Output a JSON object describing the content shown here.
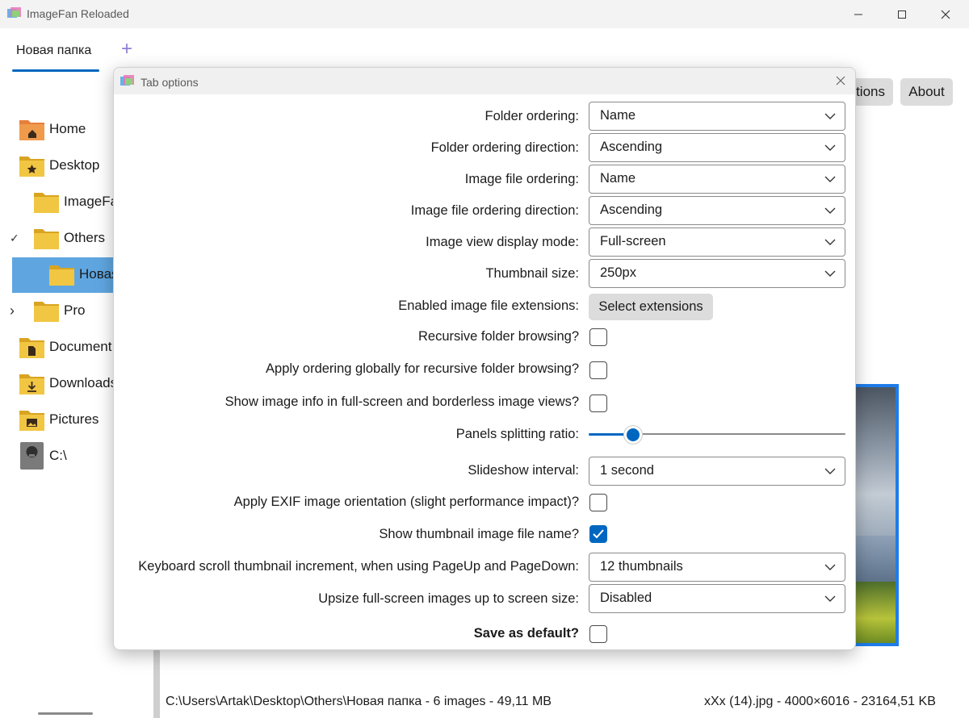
{
  "window": {
    "title": "ImageFan Reloaded",
    "tab": "Новая папка",
    "add_tab": "+",
    "options_label": "tions",
    "about_label": "About"
  },
  "sidebar": {
    "items": [
      {
        "label": "Home",
        "icon": "home-folder-icon"
      },
      {
        "label": "Desktop",
        "icon": "desktop-folder-icon"
      },
      {
        "label": "ImageFa",
        "icon": "folder-icon"
      },
      {
        "label": "Others",
        "icon": "folder-icon",
        "arrow": "✓"
      },
      {
        "label": "Новая",
        "icon": "folder-icon"
      },
      {
        "label": "Pro",
        "icon": "folder-icon",
        "arrow": "›"
      },
      {
        "label": "Document",
        "icon": "documents-folder-icon"
      },
      {
        "label": "Downloads",
        "icon": "downloads-folder-icon"
      },
      {
        "label": "Pictures",
        "icon": "pictures-folder-icon"
      },
      {
        "label": "C:\\",
        "icon": "drive-icon"
      }
    ]
  },
  "status": {
    "left": "C:\\Users\\Artak\\Desktop\\Others\\Новая папка - 6 images - 49,11 MB",
    "right": "xXx (14).jpg - 4000×6016 - 23164,51 KB"
  },
  "dialog": {
    "title": "Tab options",
    "rows": {
      "folder_ordering": {
        "label": "Folder ordering:",
        "value": "Name"
      },
      "folder_ordering_direction": {
        "label": "Folder ordering direction:",
        "value": "Ascending"
      },
      "image_file_ordering": {
        "label": "Image file ordering:",
        "value": "Name"
      },
      "image_file_ordering_direction": {
        "label": "Image file ordering direction:",
        "value": "Ascending"
      },
      "image_view_display_mode": {
        "label": "Image view display mode:",
        "value": "Full-screen"
      },
      "thumbnail_size": {
        "label": "Thumbnail size:",
        "value": "250px"
      },
      "enabled_extensions": {
        "label": "Enabled image file extensions:",
        "button": "Select extensions"
      },
      "recursive_browsing": {
        "label": "Recursive folder browsing?",
        "checked": false
      },
      "apply_ordering_globally": {
        "label": "Apply ordering globally for recursive folder browsing?",
        "checked": false
      },
      "show_image_info": {
        "label": "Show image info in full-screen and borderless image views?",
        "checked": false
      },
      "panels_splitting_ratio": {
        "label": "Panels splitting ratio:",
        "value_fraction": 0.19
      },
      "slideshow_interval": {
        "label": "Slideshow interval:",
        "value": "1 second"
      },
      "apply_exif": {
        "label": "Apply EXIF image orientation (slight performance impact)?",
        "checked": false
      },
      "show_thumbnail_name": {
        "label": "Show thumbnail image file name?",
        "checked": true
      },
      "keyboard_scroll_increment": {
        "label": "Keyboard scroll thumbnail increment, when using PageUp and PageDown:",
        "value": "12 thumbnails"
      },
      "upsize_images": {
        "label": "Upsize full-screen images up to screen size:",
        "value": "Disabled"
      },
      "save_as_default": {
        "label": "Save as default?",
        "checked": false
      }
    }
  },
  "colors": {
    "accent": "#0067c0",
    "selection": "#5fa6e0",
    "folder_yellow": "#e8b835",
    "folder_orange": "#e5803a"
  }
}
